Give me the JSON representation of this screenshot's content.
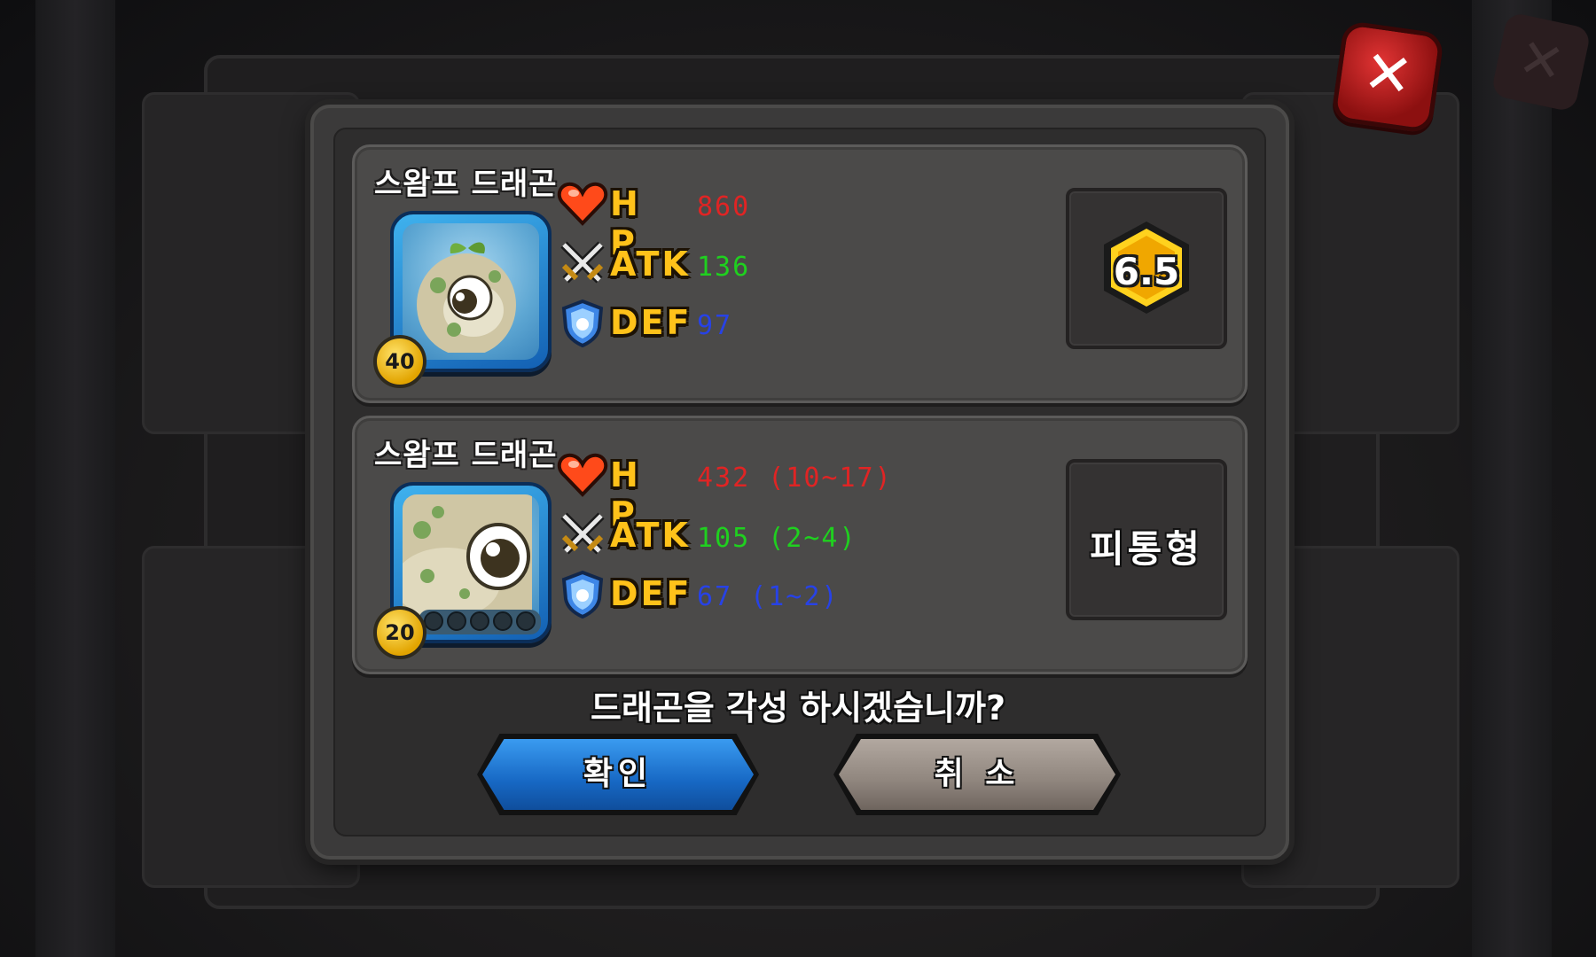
{
  "dialog": {
    "question": "드래곤을 각성 하시겠습니까?",
    "confirm_label": "확인",
    "cancel_label": "취 소",
    "close_icon": "close-x-icon"
  },
  "current": {
    "name": "스왐프 드래곤",
    "level": "40",
    "stats": {
      "hp_label": "H P",
      "hp_value": "860",
      "atk_label": "ATK",
      "atk_value": "136",
      "def_label": "DEF",
      "def_value": "97"
    },
    "rank": "6.5"
  },
  "awakened": {
    "name": "스왐프 드래곤",
    "level": "20",
    "awaken_slots": 5,
    "stats": {
      "hp_label": "H P",
      "hp_value": "432 (10~17)",
      "atk_label": "ATK",
      "atk_value": "105 (2~4)",
      "def_label": "DEF",
      "def_value": "67 (1~2)"
    },
    "type": "피통형"
  },
  "colors": {
    "hp": "#e02424",
    "atk": "#1fd01f",
    "def": "#2742e6",
    "label": "#ffc21a",
    "confirm": "#1768c4",
    "cancel": "#8f857d",
    "close": "#c91f1f"
  },
  "icons": [
    "heart-icon",
    "crossed-swords-icon",
    "shield-icon",
    "rank-hexagon-icon",
    "close-x-icon"
  ]
}
